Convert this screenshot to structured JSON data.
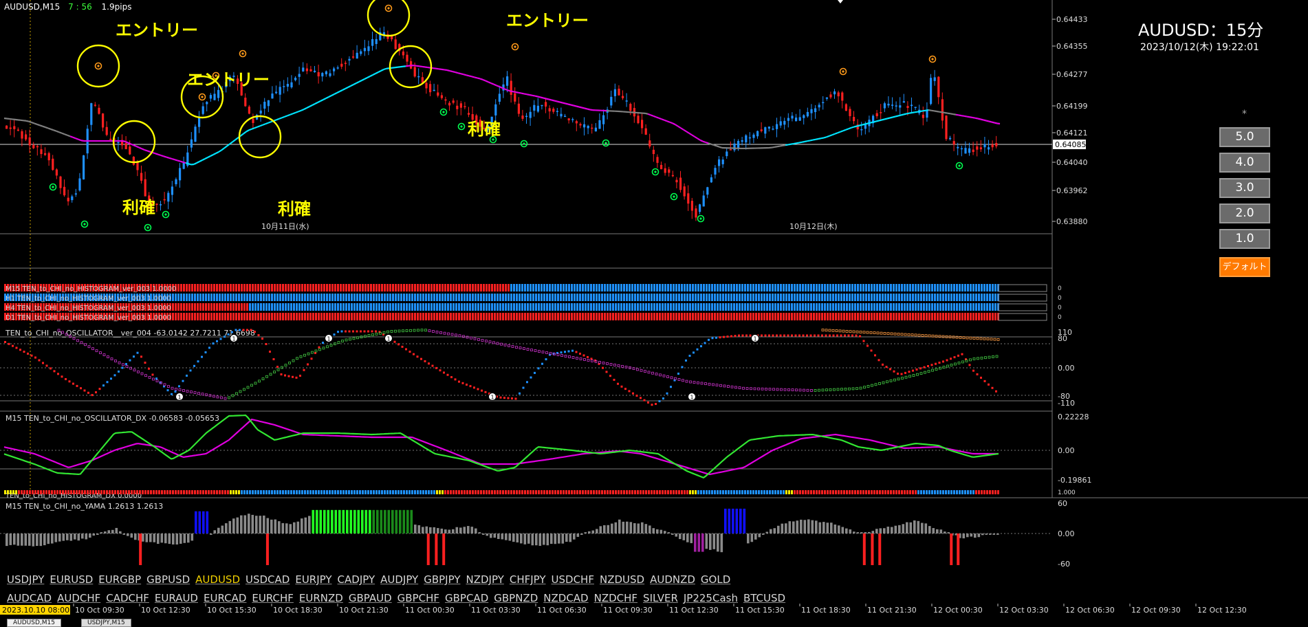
{
  "window": {
    "symbol_tf": "AUDUSD,M15",
    "countdown": "7 : 56",
    "spread": "1.9pips",
    "title_big": "AUDUSD：15分",
    "datetime": "2023/10/12(木) 19:22:01",
    "current_price": "0.64085"
  },
  "annotations": {
    "entry": "エントリー",
    "take_profit": "利確"
  },
  "price_axis": [
    "0.64433",
    "0.64355",
    "0.64277",
    "0.64199",
    "0.64121",
    "0.64040",
    "0.63962",
    "0.63880"
  ],
  "day_labels": [
    "10月11日(水)",
    "10月12日(木)"
  ],
  "zoom_buttons": [
    "5.0",
    "4.0",
    "3.0",
    "2.0",
    "1.0"
  ],
  "default_button": "デフォルト",
  "histogram_rows": [
    "M15 TEN_to_CHI_no_HISTOGRAM_ver_003 1.0000",
    "H1 TEN_to_CHI_no_HISTOGRAM_ver_003 1.0000",
    "H4 TEN_to_CHI_no_HISTOGRAM_ver_003 1.0000",
    "D1 TEN_to_CHI_no_HISTOGRAM_ver_003 1.0000"
  ],
  "oscillator": {
    "label": "TEN_to_CHI_no_OSCILLATOR__ver_004 -63.0142 27.7211 71.6698",
    "axis": [
      "110",
      "80",
      "0.00",
      "-80",
      "-110"
    ]
  },
  "oscillator_dx": {
    "label": "M15 TEN_to_CHI_no_OSCILLATOR_DX  -0.06583 -0.05653",
    "axis": [
      "0.22228",
      "0.00",
      "-0.19861"
    ]
  },
  "histogram_dx": {
    "label": "TEN_to_CHI_no_HISTOGRAM_DX 0.0000",
    "axis": [
      "1.000"
    ]
  },
  "yama": {
    "label": "M15  TEN_to_CHI_no_YAMA  1.2613 1.2613",
    "axis": [
      "60",
      "0.00",
      "-60"
    ]
  },
  "symbols_row1": [
    "USDJPY",
    "EURUSD",
    "EURGBP",
    "GBPUSD",
    "AUDUSD",
    "USDCAD",
    "EURJPY",
    "CADJPY",
    "AUDJPY",
    "GBPJPY",
    "NZDJPY",
    "CHFJPY",
    "USDCHF",
    "NZDUSD",
    "AUDNZD",
    "GOLD"
  ],
  "symbols_row2": [
    "AUDCAD",
    "AUDCHF",
    "CADCHF",
    "EURAUD",
    "EURCAD",
    "EURCHF",
    "EURNZD",
    "GBPAUD",
    "GBPCHF",
    "GBPCAD",
    "GBPNZD",
    "NZDCAD",
    "NZDCHF",
    "SILVER",
    "JP225Cash",
    "BTCUSD"
  ],
  "active_symbol": "AUDUSD",
  "time_axis": {
    "highlight": "2023.10.10 08:00",
    "labels": [
      "10 Oct 09:30",
      "10 Oct 12:30",
      "10 Oct 15:30",
      "10 Oct 18:30",
      "10 Oct 21:30",
      "11 Oct 00:30",
      "11 Oct 03:30",
      "11 Oct 06:30",
      "11 Oct 09:30",
      "11 Oct 12:30",
      "11 Oct 15:30",
      "11 Oct 18:30",
      "11 Oct 21:30",
      "12 Oct 00:30",
      "12 Oct 03:30",
      "12 Oct 06:30",
      "12 Oct 09:30",
      "12 Oct 12:30"
    ]
  },
  "tabs": [
    "AUDUSD,M15",
    "USDJPY,M15"
  ],
  "colors": {
    "bull": "#1e90ff",
    "bear": "#ff2020",
    "ma_up": "#00e5ff",
    "ma_down": "#e000e0",
    "ma_flat": "#808080",
    "annotation": "#ffff00",
    "zoom_default": "#ff7a00"
  }
}
